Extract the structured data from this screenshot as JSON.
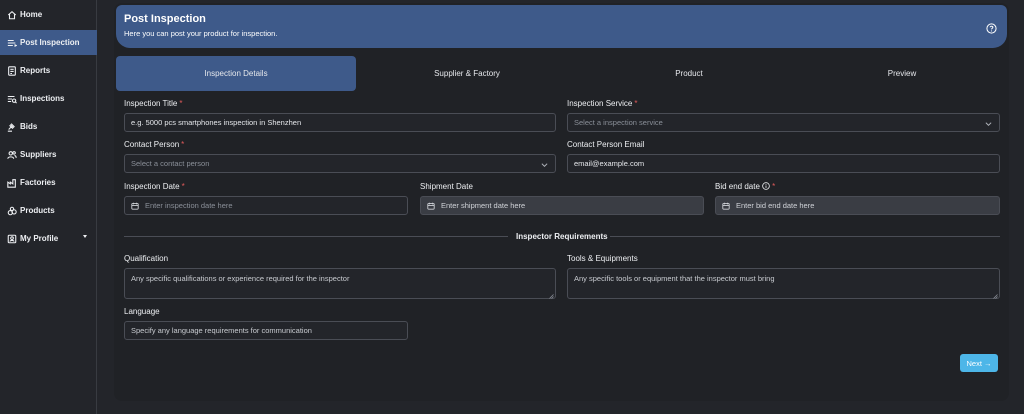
{
  "sidebar": {
    "items": [
      {
        "label": "Home",
        "icon": "home-icon"
      },
      {
        "label": "Post Inspection",
        "icon": "list-icon"
      },
      {
        "label": "Reports",
        "icon": "report-icon"
      },
      {
        "label": "Inspections",
        "icon": "inspection-icon"
      },
      {
        "label": "Bids",
        "icon": "gavel-icon"
      },
      {
        "label": "Suppliers",
        "icon": "users-icon"
      },
      {
        "label": "Factories",
        "icon": "factory-icon"
      },
      {
        "label": "Products",
        "icon": "products-icon"
      },
      {
        "label": "My Profile",
        "icon": "profile-icon"
      }
    ],
    "active_index": 1
  },
  "banner": {
    "title": "Post Inspection",
    "subtitle": "Here you can post your product for inspection."
  },
  "tabs": [
    {
      "label": "Inspection Details",
      "active": true
    },
    {
      "label": "Supplier & Factory",
      "active": false
    },
    {
      "label": "Product",
      "active": false
    },
    {
      "label": "Preview",
      "active": false
    }
  ],
  "form": {
    "inspection_title": {
      "label": "Inspection Title",
      "value": "e.g. 5000 pcs smartphones inspection in Shenzhen"
    },
    "inspection_service": {
      "label": "Inspection Service",
      "placeholder": "Select a inspection service"
    },
    "contact_person": {
      "label": "Contact Person",
      "placeholder": "Select a contact person"
    },
    "contact_email": {
      "label": "Contact Person Email",
      "value": "email@example.com"
    },
    "inspection_date": {
      "label": "Inspection Date",
      "placeholder": "Enter inspection date here"
    },
    "shipment_date": {
      "label": "Shipment Date",
      "placeholder": "Enter shipment date here"
    },
    "bid_end_date": {
      "label": "Bid end date",
      "placeholder": "Enter bid end date here"
    },
    "required_mark": "*"
  },
  "requirements": {
    "section_title": "Inspector Requirements",
    "qualification": {
      "label": "Qualification",
      "placeholder": "Any specific qualifications or experience required for the inspector"
    },
    "tools": {
      "label": "Tools & Equipments",
      "placeholder": "Any specific tools or equipment that the inspector must bring"
    },
    "language": {
      "label": "Language",
      "placeholder": "Specify any language requirements for communication"
    }
  },
  "actions": {
    "next_label": "Next →"
  },
  "colors": {
    "accent": "#3e5a8a",
    "button": "#4db6e8",
    "required": "#e05a5a",
    "background": "#23252a"
  }
}
